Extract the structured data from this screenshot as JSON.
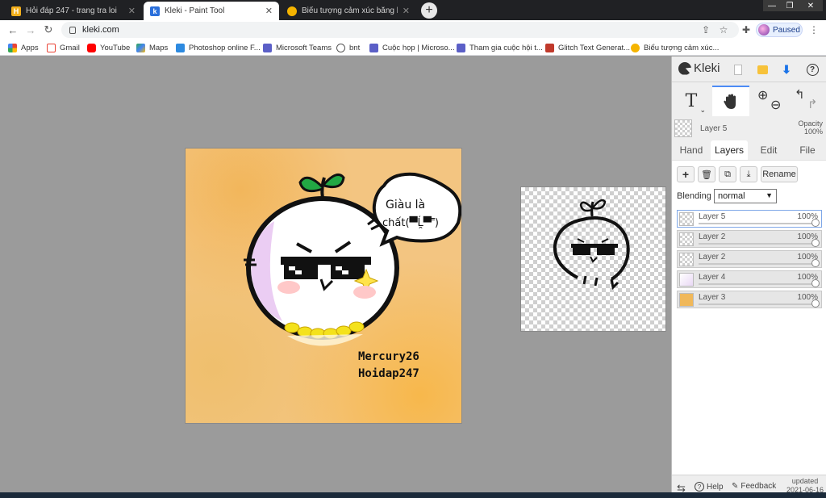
{
  "browser": {
    "tabs": [
      {
        "title": "Hỏi đáp 247 - trang tra loi",
        "close": "✕"
      },
      {
        "title": "Kleki - Paint Tool",
        "close": "✕"
      },
      {
        "title": "Biểu tượng cảm xúc bằng ký tự I",
        "close": "✕"
      }
    ],
    "new_tab": "+",
    "window_controls": {
      "minimize": "—",
      "restore": "❐",
      "close": "✕"
    },
    "url": "kleki.com",
    "profile_label": "Paused",
    "bookmarks": [
      {
        "label": "Apps"
      },
      {
        "label": "Gmail"
      },
      {
        "label": "YouTube"
      },
      {
        "label": "Maps"
      },
      {
        "label": "Photoshop online F..."
      },
      {
        "label": "Microsoft Teams"
      },
      {
        "label": "bnt"
      },
      {
        "label": "Cuộc họp | Microso..."
      },
      {
        "label": "Tham gia cuộc hội t..."
      },
      {
        "label": "Glitch Text Generat..."
      },
      {
        "label": "Biểu tượng cảm xúc..."
      }
    ]
  },
  "canvas": {
    "bubble_line1": "Giàu là",
    "bubble_line2": "chất(▀̿Ĺ̯▀̿ ̿)",
    "signature_line1": "Mercury26",
    "signature_line2": "Hoidap247"
  },
  "panel": {
    "app_name": "Kleki",
    "tool_text_glyph": "T",
    "current_layer": {
      "name": "Layer 5",
      "opacity_label": "Opacity",
      "opacity_value": "100%"
    },
    "tabs": [
      {
        "label": "Hand"
      },
      {
        "label": "Layers"
      },
      {
        "label": "Edit"
      },
      {
        "label": "File"
      }
    ],
    "layer_buttons": {
      "add": "+",
      "delete": "🗑",
      "duplicate": "⧉",
      "merge": "⤓",
      "rename": "Rename"
    },
    "blending_label": "Blending",
    "blending_value": "normal",
    "layers": [
      {
        "name": "Layer 5",
        "opacity": "100%"
      },
      {
        "name": "Layer 2",
        "opacity": "100%"
      },
      {
        "name": "Layer 2",
        "opacity": "100%"
      },
      {
        "name": "Layer 4",
        "opacity": "100%"
      },
      {
        "name": "Layer 3",
        "opacity": "100%"
      }
    ],
    "footer": {
      "help": "Help",
      "feedback": "Feedback",
      "updated_label": "updated",
      "updated_date": "2021-06-16"
    }
  },
  "colors": {
    "accent": "#4d8cf5",
    "canvas_bg": "#f3c581",
    "download": "#1a73e8"
  }
}
